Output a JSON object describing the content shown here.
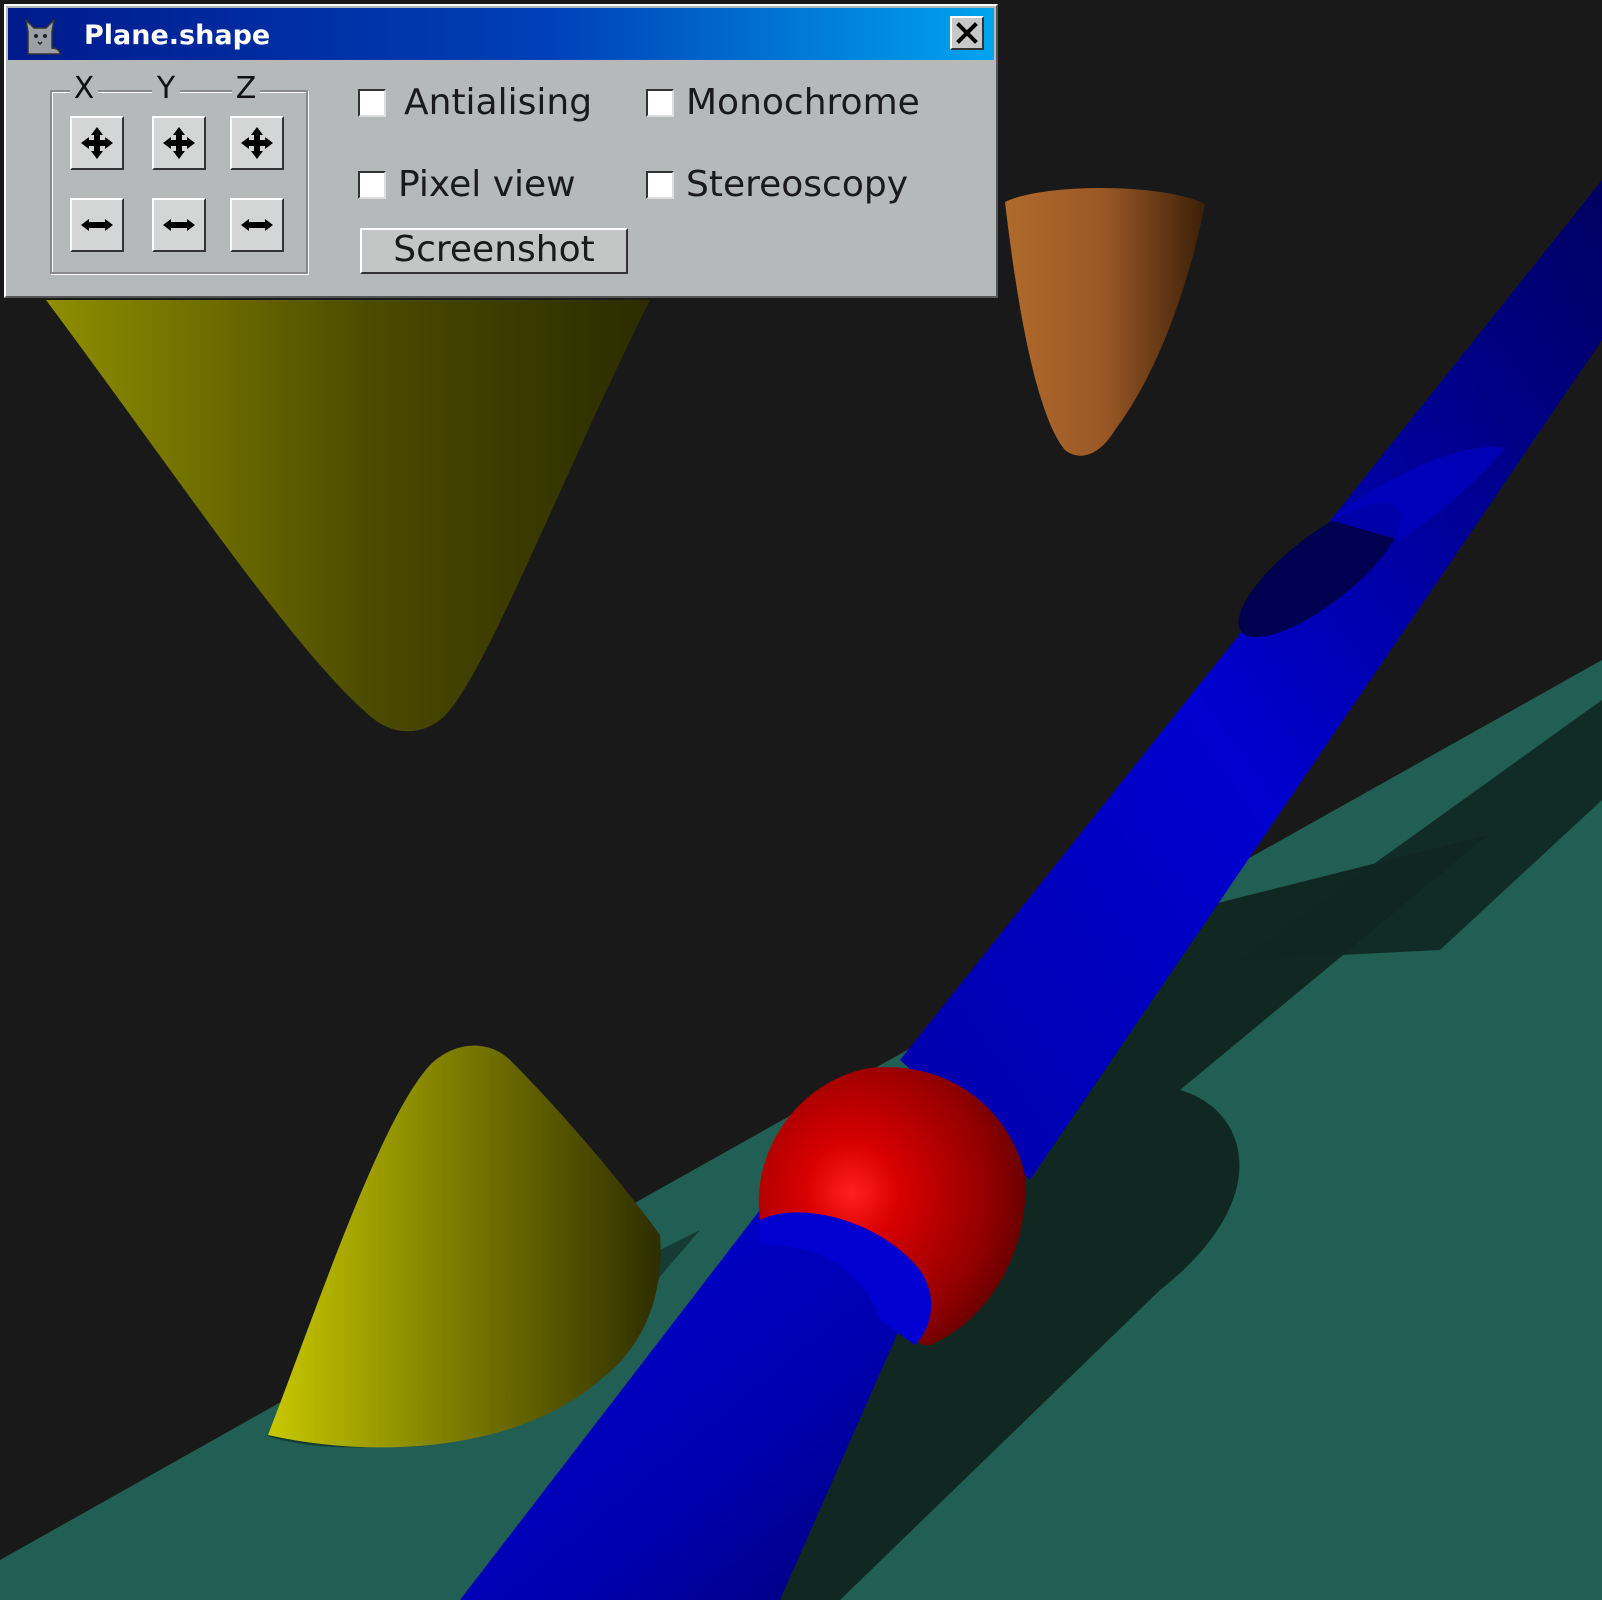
{
  "window": {
    "title": "Plane.shape",
    "app_icon": "cat-icon",
    "close_icon": "close-icon"
  },
  "axes": {
    "labels": [
      "X",
      "Y",
      "Z"
    ],
    "increase_icon": "plus-arrows-icon",
    "decrease_icon": "minus-arrows-icon"
  },
  "options": {
    "antialising": {
      "label": "Antialising",
      "checked": false
    },
    "monochrome": {
      "label": "Monochrome",
      "checked": false
    },
    "pixel_view": {
      "label": "Pixel view",
      "checked": false
    },
    "stereoscopy": {
      "label": "Stereoscopy",
      "checked": false
    }
  },
  "screenshot_button": {
    "label": "Screenshot"
  },
  "scene": {
    "background_color": "#191919",
    "plane_color": "#215e53",
    "shadow_color": "#102722",
    "cylinder_color": "#0000c8",
    "sphere_color": "#cc0000",
    "cone_color": "#a8a800",
    "paraboloid_color": "#b36a30"
  }
}
